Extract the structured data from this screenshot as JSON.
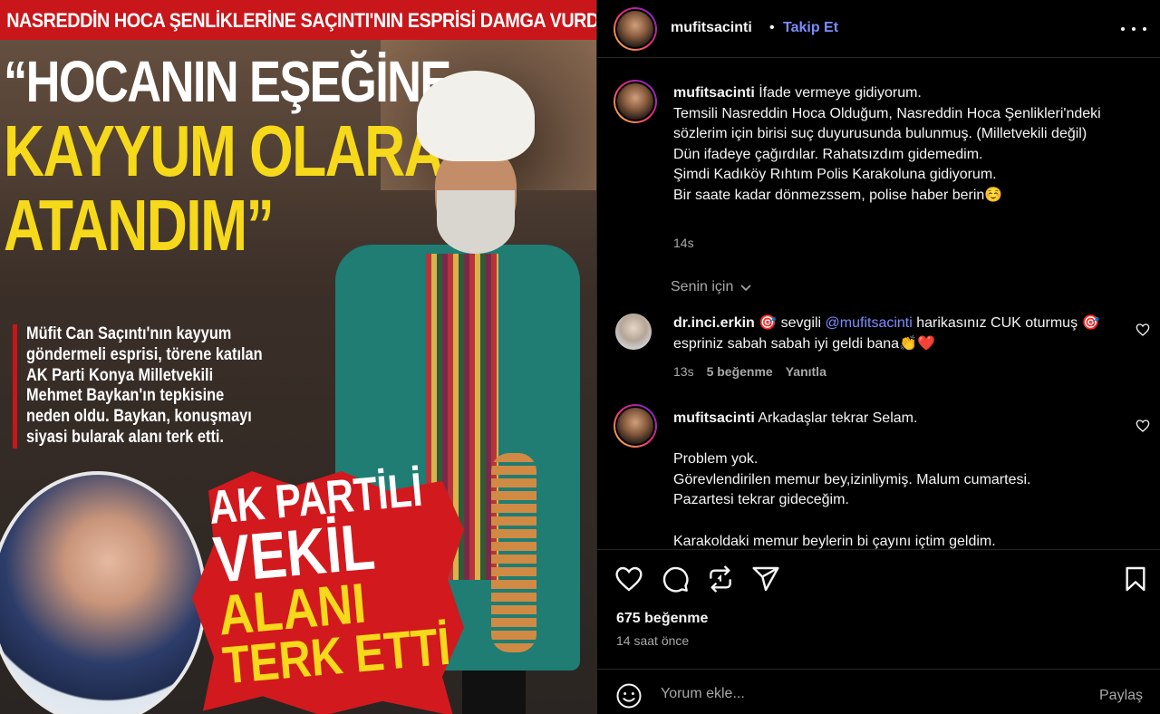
{
  "media": {
    "banner": "NASREDDİN HOCA ŞENLİKLERİNE SAÇINTI'NIN ESPRİSİ DAMGA VURDU",
    "headline_l1": "“HOCANIN EŞEĞİNE",
    "headline_l2": "KAYYUM OLARAK",
    "headline_l3": "ATANDIM”",
    "sub": [
      "Müfit Can Saçıntı'nın kayyum",
      "göndermeli esprisi, törene katılan",
      "AK Parti Konya Milletvekili",
      "Mehmet Baykan'ın tepkisine",
      "neden oldu. Baykan, konuşmayı",
      "siyasi bularak alanı terk etti."
    ],
    "burst": [
      "AK PARTİLİ",
      "VEKİL",
      "ALANI",
      "TERK ETTİ"
    ]
  },
  "header": {
    "username": "mufitsacinti",
    "separator": "•",
    "follow": "Takip Et"
  },
  "caption": {
    "username": "mufitsacinti",
    "text": " İfade vermeye gidiyorum.\nTemsili Nasreddin Hoca Olduğum, Nasreddin Hoca Şenlikleri'ndeki sözlerim için birisi suç duyurusunda bulunmuş. (Milletvekili değil)\nDün ifadeye çağırdılar. Rahatsızdım gidemedim.\nŞimdi Kadıköy Rıhtım Polis Karakoluna gidiyorum.\nBir saate kadar dönmezssem, polise haber berin☺️",
    "time": "14s"
  },
  "for_you": "Senin için",
  "comment1": {
    "username": "dr.inci.erkin",
    "pre": " 🎯 sevgili ",
    "mention": "@mufitsacinti",
    "post": " harikasınız CUK oturmuş 🎯 espriniz sabah sabah iyi geldi bana👏❤️",
    "time": "13s",
    "likes": "5 beğenme",
    "reply": "Yanıtla"
  },
  "comment2": {
    "username": "mufitsacinti",
    "text": " Arkadaşlar tekrar Selam.\n\nProblem yok.\nGörevlendirilen memur bey,izinliymiş. Malum cumartesi.\nPazartesi tekrar gideceğim.\n\nKarakoldaki memur beylerin bi çayını içtim geldim."
  },
  "footer": {
    "likes": "675 beğenme",
    "time": "14 saat önce",
    "placeholder": "Yorum ekle...",
    "share": "Paylaş"
  },
  "icons": [
    "heart-icon",
    "comment-icon",
    "repost-icon",
    "send-icon",
    "bookmark-icon",
    "emoji-icon",
    "more-icon",
    "chevron-down-icon"
  ]
}
